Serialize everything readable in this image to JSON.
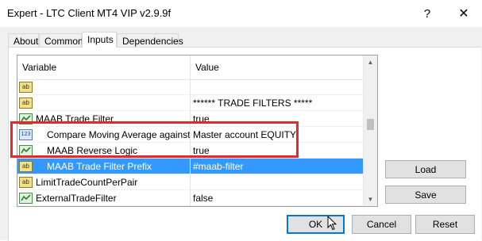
{
  "window": {
    "title": "Expert - LTC Client MT4 VIP v2.9.9f",
    "help_glyph": "?",
    "close_glyph": "✕"
  },
  "tabs": [
    {
      "label": "About",
      "active": false
    },
    {
      "label": "Common",
      "active": false
    },
    {
      "label": "Inputs",
      "active": true
    },
    {
      "label": "Dependencies",
      "active": false
    }
  ],
  "grid": {
    "headers": {
      "variable": "Variable",
      "value": "Value"
    },
    "rows": [
      {
        "icon": "ab",
        "variable": "",
        "value": ""
      },
      {
        "icon": "ab",
        "variable": "",
        "value": "****** TRADE FILTERS *****"
      },
      {
        "icon": "bool",
        "variable": "MAAB Trade Filter",
        "value": "true"
      },
      {
        "icon": "123",
        "variable": "Compare Moving Average against ...",
        "value": "Master account EQUITY"
      },
      {
        "icon": "bool",
        "variable": "MAAB Reverse Logic",
        "value": "true"
      },
      {
        "icon": "ab",
        "variable": "MAAB Trade Filter Prefix",
        "value": "#maab-filter"
      },
      {
        "icon": "ab",
        "variable": "LimitTradeCountPerPair",
        "value": ""
      },
      {
        "icon": "bool",
        "variable": "ExternalTradeFilter",
        "value": "false"
      }
    ],
    "selected_row": 5,
    "indented_rows": [
      3,
      4,
      5
    ]
  },
  "side_buttons": {
    "load": "Load",
    "save": "Save"
  },
  "footer_buttons": {
    "ok": "OK",
    "cancel": "Cancel",
    "reset": "Reset"
  },
  "colors": {
    "selection": "#3399ff",
    "highlight_box": "#e8272b",
    "default_button_border": "#0078d7"
  }
}
